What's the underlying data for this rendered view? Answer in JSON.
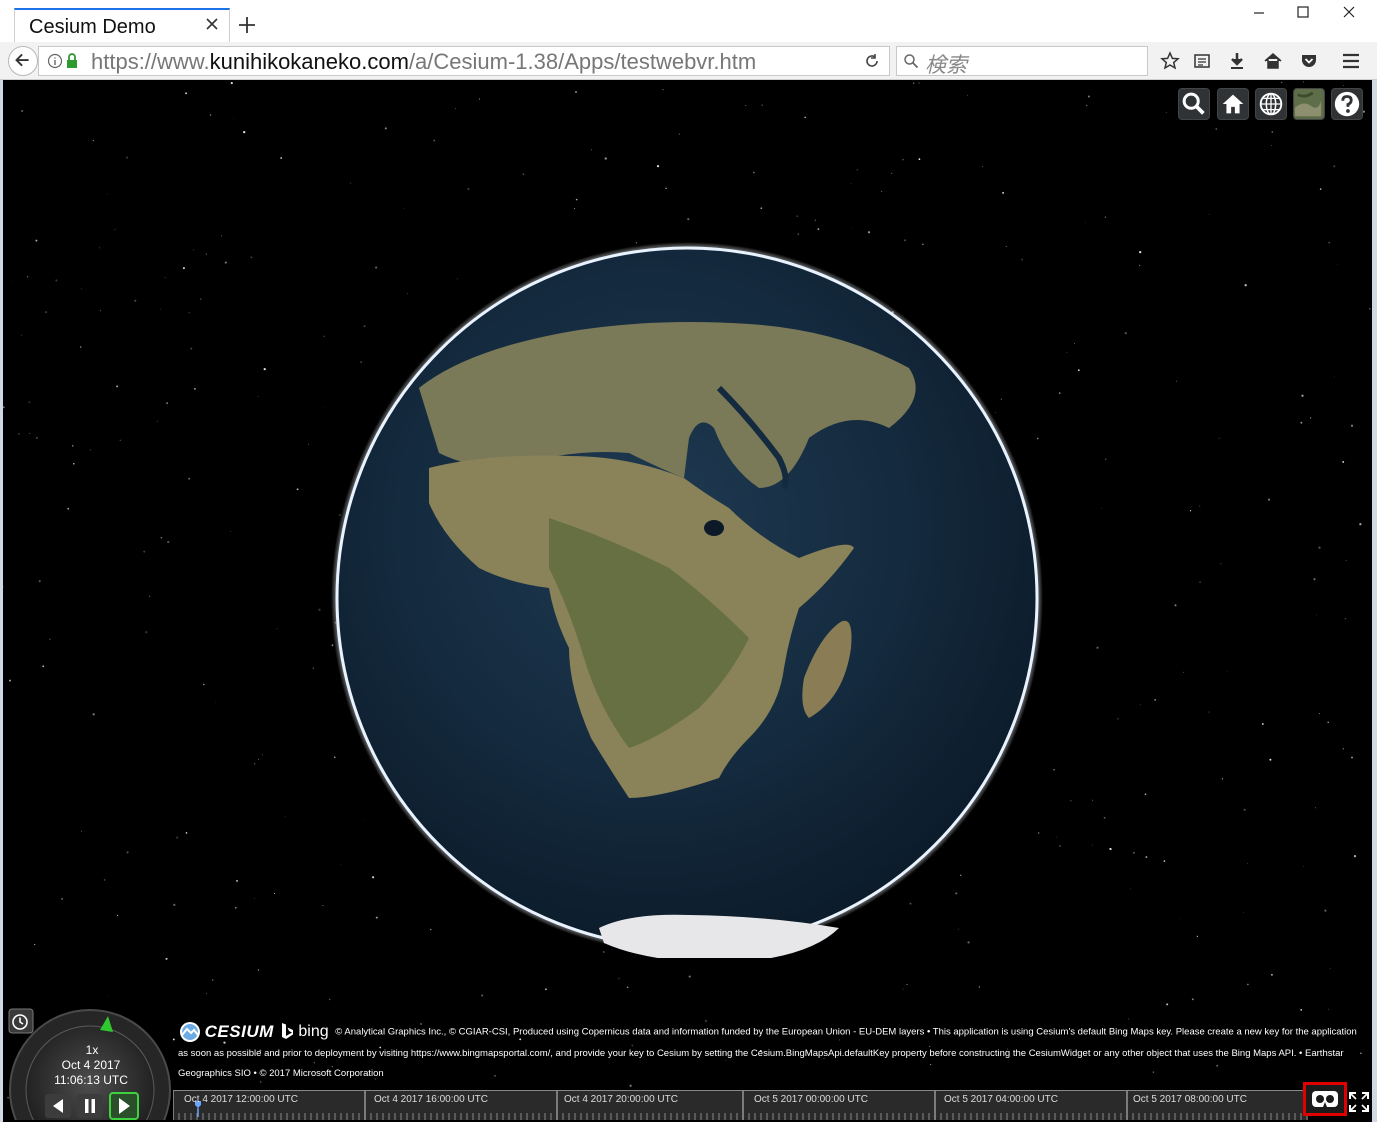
{
  "browser": {
    "tab_title": "Cesium Demo",
    "url_scheme": "https://www.",
    "url_host": "kunihikokaneko.com",
    "url_path": "/a/Cesium-1.38/Apps/testwebvr.htm",
    "search_placeholder": "検索"
  },
  "icons": {
    "close": "close-icon",
    "new_tab": "plus-icon",
    "back": "back-arrow-icon",
    "info": "info-icon",
    "lock": "lock-icon",
    "reload": "reload-icon",
    "search": "search-icon",
    "bookmark": "star-icon",
    "reader": "reading-list-icon",
    "download": "download-icon",
    "home": "home-icon",
    "pocket": "pocket-icon",
    "menu": "hamburger-menu-icon"
  },
  "viewer": {
    "toolbar": [
      "geocoder-search",
      "home-view",
      "scene-mode-globe",
      "base-layer-picker",
      "navigation-help"
    ],
    "credits": {
      "cesium_logo": "CESIUM",
      "bing_logo": "bing",
      "text": "© Analytical Graphics Inc., © CGIAR-CSI, Produced using Copernicus data and information funded by the European Union - EU-DEM layers • This application is using Cesium's default Bing Maps key. Please create a new key for the application as soon as possible and prior to deployment by visiting https://www.bingmapsportal.com/, and provide your key to Cesium by setting the Cesium.BingMapsApi.defaultKey property before constructing the CesiumWidget or any other object that uses the Bing Maps API. • Earthstar Geographics SIO • © 2017 Microsoft Corporation"
    },
    "animation": {
      "speed": "1x",
      "date": "Oct 4 2017",
      "time": "11:06:13 UTC"
    },
    "timeline": {
      "labels": [
        "Oct 4 2017 12:00:00 UTC",
        "Oct 4 2017 16:00:00 UTC",
        "Oct 4 2017 20:00:00 UTC",
        "Oct 5 2017 00:00:00 UTC",
        "Oct 5 2017 04:00:00 UTC",
        "Oct 5 2017 08:00:00 UTC"
      ]
    },
    "highlight_color": "#e00000"
  }
}
